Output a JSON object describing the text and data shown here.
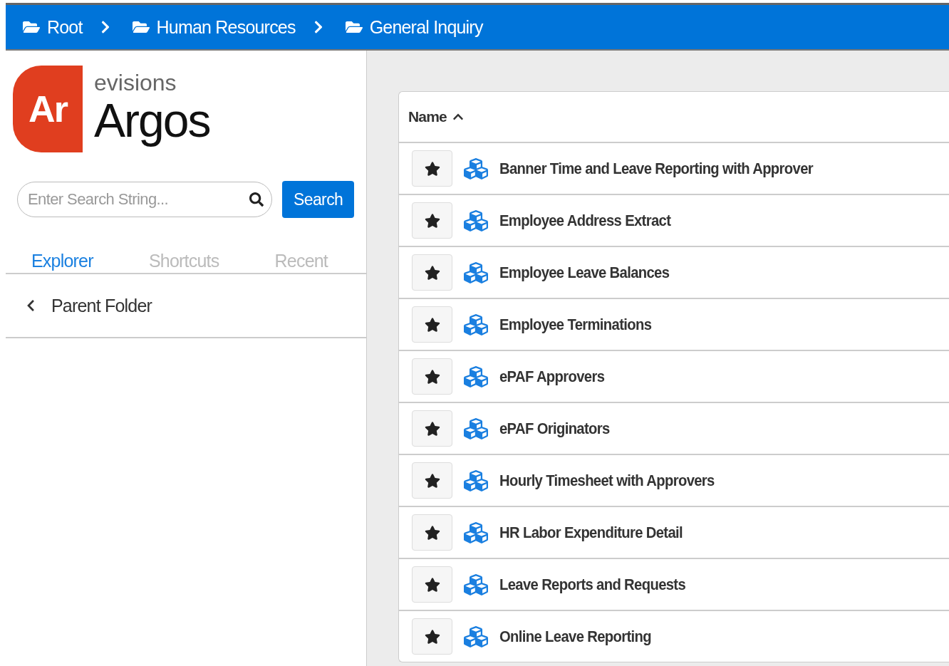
{
  "breadcrumb": [
    {
      "label": "Root"
    },
    {
      "label": "Human Resources"
    },
    {
      "label": "General Inquiry"
    }
  ],
  "logo": {
    "mark": "Ar",
    "company": "evisions",
    "product": "Argos"
  },
  "search": {
    "placeholder": "Enter Search String...",
    "button": "Search"
  },
  "tabs": [
    {
      "label": "Explorer",
      "selected": true
    },
    {
      "label": "Shortcuts",
      "selected": false
    },
    {
      "label": "Recent",
      "selected": false
    }
  ],
  "parent_folder": "Parent Folder",
  "table": {
    "columns": [
      {
        "label": "Name",
        "sort_ascending": true
      }
    ],
    "rows": [
      {
        "name": "Banner Time and Leave Reporting with Approver"
      },
      {
        "name": "Employee Address Extract"
      },
      {
        "name": "Employee Leave Balances"
      },
      {
        "name": "Employee Terminations"
      },
      {
        "name": "ePAF Approvers"
      },
      {
        "name": "ePAF Originators"
      },
      {
        "name": "Hourly Timesheet with Approvers"
      },
      {
        "name": "HR Labor Expenditure Detail"
      },
      {
        "name": "Leave Reports and Requests"
      },
      {
        "name": "Online Leave Reporting"
      }
    ]
  }
}
